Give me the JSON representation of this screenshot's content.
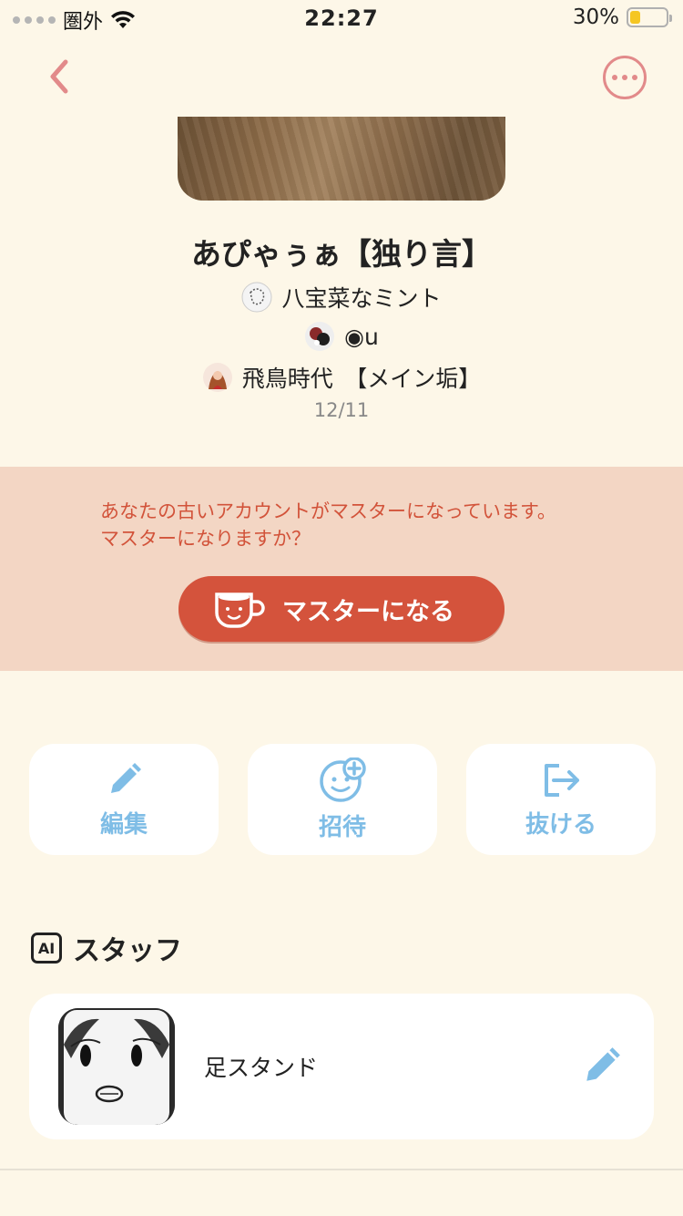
{
  "status_bar": {
    "carrier": "圏外",
    "time": "22:27",
    "battery": "30%",
    "battery_level": 0.3
  },
  "nav": {
    "back_icon": "chevron-left-icon",
    "more_icon": "ellipsis-icon"
  },
  "room": {
    "title": "あぴゃぅぁ【独り言】",
    "members": [
      {
        "name": "八宝菜なミント"
      },
      {
        "name": "◉u"
      },
      {
        "name": "飛鳥時代　【メイン垢】"
      }
    ],
    "date": "12/11"
  },
  "master_banner": {
    "message_line1": "あなたの古いアカウントがマスターになっています。",
    "message_line2": "マスターになりますか？",
    "button_label": "マスターになる"
  },
  "actions": {
    "edit": "編集",
    "invite": "招待",
    "leave": "抜ける"
  },
  "staff": {
    "badge": "AI",
    "title": "スタッフ",
    "items": [
      {
        "name": "足スタンド"
      }
    ]
  },
  "colors": {
    "background": "#fdf7e8",
    "accent_red": "#d4533c",
    "accent_blue": "#7fbde6",
    "nav_pink": "#e28a8a"
  }
}
